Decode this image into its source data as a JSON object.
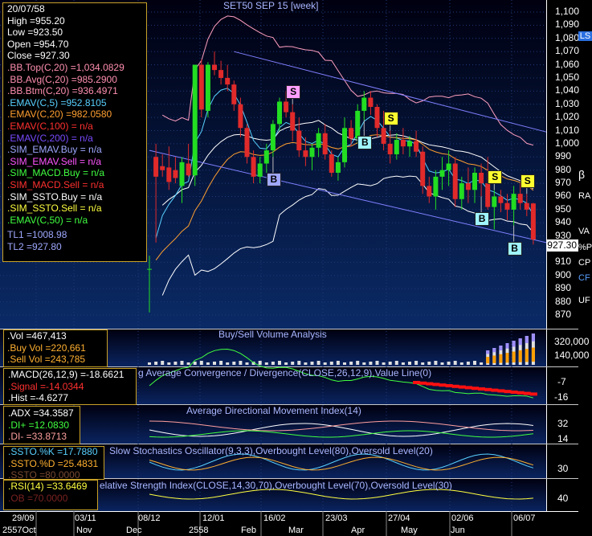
{
  "title": "SET50 SEP 15  [week]",
  "info": {
    "date": "20/07/58",
    "high": "High  =955.20",
    "low": "Low  =923.50",
    "open": "Open  =954.70",
    "close": "Close  =927.30",
    "indicators": [
      {
        "text": ".BB.Top(C,20)  =1,034.0829",
        "color": "#ff8fb0"
      },
      {
        "text": ".BB.Avg(C,20)  =985.2900",
        "color": "#ff8fb0"
      },
      {
        "text": ".BB.Btm(C,20)  =936.4971",
        "color": "#ff8fb0"
      },
      {
        "text": ".EMAV(C,5)  =952.8105",
        "color": "#58d0ff"
      },
      {
        "text": ".EMAV(C,20)  =982.0580",
        "color": "#ff9f30"
      },
      {
        "text": ".EMAV(C,100)  = n/a",
        "color": "#ff3030"
      },
      {
        "text": ".EMAV(C,200)  = n/a",
        "color": "#7a4bff"
      },
      {
        "text": ".SIM_EMAV.Buy  = n/a",
        "color": "#9fa8ff"
      },
      {
        "text": ".SIM_EMAV.Sell  = n/a",
        "color": "#ff55ff"
      },
      {
        "text": ".SIM_MACD.Buy  = n/a",
        "color": "#40ff40"
      },
      {
        "text": ".SIM_MACD.Sell  = n/a",
        "color": "#ff3030"
      },
      {
        "text": ".SIM_SSTO.Buy  = n/a",
        "color": "#ffffff"
      },
      {
        "text": ".SIM_SSTO.Sell  = n/a",
        "color": "#ffff40"
      },
      {
        "text": ".EMAV(C,50)  = n/a",
        "color": "#40ff40"
      },
      {
        "text": "TL1 =1008.98",
        "color": "#9fa8ff"
      },
      {
        "text": "TL2 =927.80",
        "color": "#9fa8ff"
      }
    ]
  },
  "volume": {
    "title": "Buy/Sell Volume Analysis",
    "vol": ".Vol  =467,413",
    "buy": ".Buy Vol  =220,661",
    "sell": ".Sell Vol  =243,785",
    "axis": [
      "320,000",
      "140,000"
    ]
  },
  "macd": {
    "title": "g Average Convergence / Divergence(CLOSE,26,12,9),Value Line(0)",
    "macd": ".MACD(26,12,9)  =-18.6621",
    "signal": ".Signal  =-14.0344",
    "hist": ".Hist  =-4.6277",
    "axis": [
      "-7",
      "-16"
    ]
  },
  "adx": {
    "title": "Average Directional Movement Index(14)",
    "adx": ".ADX  =34.3587",
    "diplus": ".DI+  =12.0830",
    "diminus": ".DI-  =33.8713",
    "axis": [
      "32",
      "14"
    ]
  },
  "ssto": {
    "title": "Slow Stochastics Oscillator(9,3,3),Overbought Level(80),Oversold Level(20)",
    "k": ".SSTO.%K  =17.7880",
    "d": ".SSTO.%D  =25.4831",
    "extra": ".SSTO  =80.0000",
    "axis": [
      "30"
    ]
  },
  "rsi": {
    "title": "elative Strength Index(CLOSE,14,30,70),Overbought Level(70),Oversold Level(30)",
    "rsi": ".RSI(14)  =33.6469",
    "extra": ".OB  =70.0000",
    "axis": [
      "40"
    ]
  },
  "price_axis": [
    "1,100",
    "1,090",
    "1,080",
    "1,070",
    "1,060",
    "1,050",
    "1,040",
    "1,030",
    "1,020",
    "1,010",
    "1,000",
    "990",
    "980",
    "970",
    "960",
    "950",
    "940",
    "930",
    "920",
    "910",
    "900",
    "890",
    "880",
    "870"
  ],
  "last_price": "927.30",
  "dates": [
    "29/09",
    "03/11",
    "08/12",
    "12/01",
    "16/02",
    "23/03",
    "27/04",
    "02/06",
    "06/07"
  ],
  "months": [
    "2557Oct",
    "Nov",
    "Dec",
    "2558",
    "Feb",
    "Mar",
    "Apr",
    "May",
    "Jun"
  ],
  "side_buttons": [
    "LS",
    "β",
    "RA",
    "VA",
    "%P",
    "CP",
    "CF",
    "UF"
  ],
  "signals": [
    {
      "type": "B",
      "bar": 19,
      "pos": "below"
    },
    {
      "type": "S",
      "bar": 22,
      "pos": "above"
    },
    {
      "type": "B",
      "bar": 33,
      "pos": "below"
    },
    {
      "type": "S",
      "bar": 37,
      "pos": "above"
    },
    {
      "type": "B",
      "bar": 51,
      "pos": "below"
    },
    {
      "type": "S",
      "bar": 53,
      "pos": "above"
    },
    {
      "type": "B",
      "bar": 56,
      "pos": "below"
    },
    {
      "type": "S",
      "bar": 58,
      "pos": "above"
    }
  ],
  "colors": {
    "up": "#22dd22",
    "down": "#e12a2a",
    "bg_top": "#000010",
    "bg_bottom": "#0a2a66"
  },
  "chart_data": {
    "type": "candlestick",
    "title": "SET50 SEP 15  [week]",
    "ylim": [
      860,
      1105
    ],
    "bars": [
      {
        "o": 905,
        "h": 915,
        "l": 872,
        "c": 905
      },
      {
        "o": 990,
        "h": 1000,
        "l": 925,
        "c": 975
      },
      {
        "o": 983,
        "h": 992,
        "l": 975,
        "c": 980
      },
      {
        "o": 982,
        "h": 998,
        "l": 965,
        "c": 971
      },
      {
        "o": 980,
        "h": 990,
        "l": 970,
        "c": 974
      },
      {
        "o": 968,
        "h": 990,
        "l": 955,
        "c": 986
      },
      {
        "o": 985,
        "h": 1000,
        "l": 975,
        "c": 976
      },
      {
        "o": 976,
        "h": 1060,
        "l": 968,
        "c": 1060
      },
      {
        "o": 1060,
        "h": 1064,
        "l": 1020,
        "c": 1026
      },
      {
        "o": 1025,
        "h": 1062,
        "l": 1020,
        "c": 1060
      },
      {
        "o": 1060,
        "h": 1070,
        "l": 1052,
        "c": 1056
      },
      {
        "o": 1056,
        "h": 1063,
        "l": 1045,
        "c": 1050
      },
      {
        "o": 1050,
        "h": 1060,
        "l": 1040,
        "c": 1045
      },
      {
        "o": 1045,
        "h": 1048,
        "l": 1025,
        "c": 1030
      },
      {
        "o": 1030,
        "h": 1035,
        "l": 1005,
        "c": 1012
      },
      {
        "o": 1012,
        "h": 1015,
        "l": 985,
        "c": 990
      },
      {
        "o": 990,
        "h": 995,
        "l": 970,
        "c": 975
      },
      {
        "o": 975,
        "h": 990,
        "l": 970,
        "c": 985
      },
      {
        "o": 985,
        "h": 1000,
        "l": 978,
        "c": 995
      },
      {
        "o": 995,
        "h": 1018,
        "l": 990,
        "c": 1015
      },
      {
        "o": 1015,
        "h": 1035,
        "l": 1010,
        "c": 1032
      },
      {
        "o": 1032,
        "h": 1040,
        "l": 1020,
        "c": 1024
      },
      {
        "o": 1024,
        "h": 1030,
        "l": 1002,
        "c": 1010
      },
      {
        "o": 1010,
        "h": 1020,
        "l": 990,
        "c": 995
      },
      {
        "o": 995,
        "h": 1005,
        "l": 983,
        "c": 990
      },
      {
        "o": 990,
        "h": 1000,
        "l": 980,
        "c": 997
      },
      {
        "o": 997,
        "h": 1012,
        "l": 990,
        "c": 1008
      },
      {
        "o": 1008,
        "h": 1015,
        "l": 988,
        "c": 992
      },
      {
        "o": 992,
        "h": 995,
        "l": 975,
        "c": 978
      },
      {
        "o": 978,
        "h": 990,
        "l": 972,
        "c": 986
      },
      {
        "o": 986,
        "h": 1020,
        "l": 982,
        "c": 1012
      },
      {
        "o": 1012,
        "h": 1018,
        "l": 998,
        "c": 1004
      },
      {
        "o": 1004,
        "h": 1030,
        "l": 1000,
        "c": 1025
      },
      {
        "o": 1025,
        "h": 1040,
        "l": 1018,
        "c": 1035
      },
      {
        "o": 1035,
        "h": 1040,
        "l": 1022,
        "c": 1028
      },
      {
        "o": 1028,
        "h": 1030,
        "l": 1005,
        "c": 1012
      },
      {
        "o": 1012,
        "h": 1025,
        "l": 995,
        "c": 1000
      },
      {
        "o": 1000,
        "h": 1010,
        "l": 985,
        "c": 992
      },
      {
        "o": 992,
        "h": 1008,
        "l": 988,
        "c": 1003
      },
      {
        "o": 1003,
        "h": 1012,
        "l": 992,
        "c": 998
      },
      {
        "o": 998,
        "h": 1006,
        "l": 990,
        "c": 1002
      },
      {
        "o": 1002,
        "h": 1010,
        "l": 990,
        "c": 994
      },
      {
        "o": 994,
        "h": 998,
        "l": 962,
        "c": 968
      },
      {
        "o": 968,
        "h": 975,
        "l": 955,
        "c": 960
      },
      {
        "o": 960,
        "h": 980,
        "l": 950,
        "c": 975
      },
      {
        "o": 975,
        "h": 990,
        "l": 965,
        "c": 980
      },
      {
        "o": 980,
        "h": 995,
        "l": 968,
        "c": 985
      },
      {
        "o": 985,
        "h": 990,
        "l": 952,
        "c": 958
      },
      {
        "o": 958,
        "h": 975,
        "l": 950,
        "c": 970
      },
      {
        "o": 970,
        "h": 982,
        "l": 955,
        "c": 965
      },
      {
        "o": 965,
        "h": 982,
        "l": 955,
        "c": 978
      },
      {
        "o": 978,
        "h": 985,
        "l": 960,
        "c": 970
      },
      {
        "o": 970,
        "h": 990,
        "l": 950,
        "c": 952
      },
      {
        "o": 952,
        "h": 965,
        "l": 935,
        "c": 960
      },
      {
        "o": 960,
        "h": 965,
        "l": 948,
        "c": 955
      },
      {
        "o": 955,
        "h": 962,
        "l": 942,
        "c": 950
      },
      {
        "o": 950,
        "h": 968,
        "l": 938,
        "c": 962
      },
      {
        "o": 962,
        "h": 970,
        "l": 950,
        "c": 955
      },
      {
        "o": 955,
        "h": 962,
        "l": 945,
        "c": 950
      },
      {
        "o": 954.7,
        "h": 955.2,
        "l": 923.5,
        "c": 927.3
      }
    ]
  }
}
